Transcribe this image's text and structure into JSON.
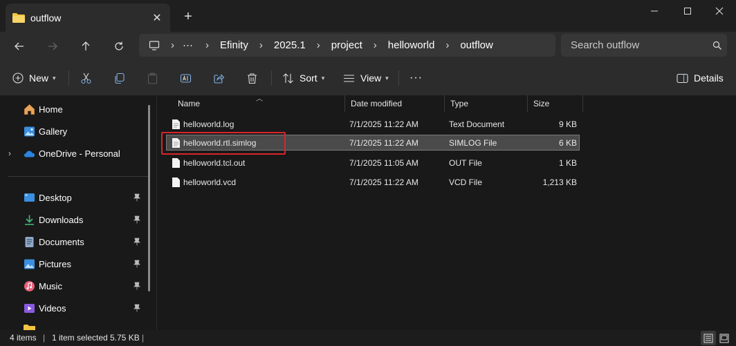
{
  "window": {
    "tab_title": "outflow",
    "tab_close": "✕",
    "new_tab": "+"
  },
  "address": {
    "overflow": "···",
    "breadcrumbs": [
      "Efinity",
      "2025.1",
      "project",
      "helloworld",
      "outflow"
    ],
    "search_placeholder": "Search outflow"
  },
  "commandbar": {
    "new_label": "New",
    "sort_label": "Sort",
    "view_label": "View",
    "more_label": "···",
    "details_label": "Details"
  },
  "nav": {
    "top_items": [
      {
        "label": "Home",
        "icon": "home-icon"
      },
      {
        "label": "Gallery",
        "icon": "gallery-icon"
      },
      {
        "label": "OneDrive - Personal",
        "icon": "cloud-icon"
      }
    ],
    "pinned_items": [
      {
        "label": "Desktop",
        "icon": "desktop-icon"
      },
      {
        "label": "Downloads",
        "icon": "download-icon"
      },
      {
        "label": "Documents",
        "icon": "documents-icon"
      },
      {
        "label": "Pictures",
        "icon": "pictures-icon"
      },
      {
        "label": "Music",
        "icon": "music-icon"
      },
      {
        "label": "Videos",
        "icon": "videos-icon"
      }
    ]
  },
  "columns": {
    "name": "Name",
    "date": "Date modified",
    "type": "Type",
    "size": "Size"
  },
  "files": [
    {
      "name": "helloworld.log",
      "date": "7/1/2025 11:22 AM",
      "type": "Text Document",
      "size": "9 KB"
    },
    {
      "name": "helloworld.rtl.simlog",
      "date": "7/1/2025 11:22 AM",
      "type": "SIMLOG File",
      "size": "6 KB"
    },
    {
      "name": "helloworld.tcl.out",
      "date": "7/1/2025 11:05 AM",
      "type": "OUT File",
      "size": "1 KB"
    },
    {
      "name": "helloworld.vcd",
      "date": "7/1/2025 11:22 AM",
      "type": "VCD File",
      "size": "1,213 KB"
    }
  ],
  "status": {
    "item_count": "4 items",
    "selected": "1 item selected",
    "selected_size": "5.75 KB"
  },
  "colors": {
    "accent_folder": "#f4c542",
    "highlight_box": "#d9252b"
  }
}
